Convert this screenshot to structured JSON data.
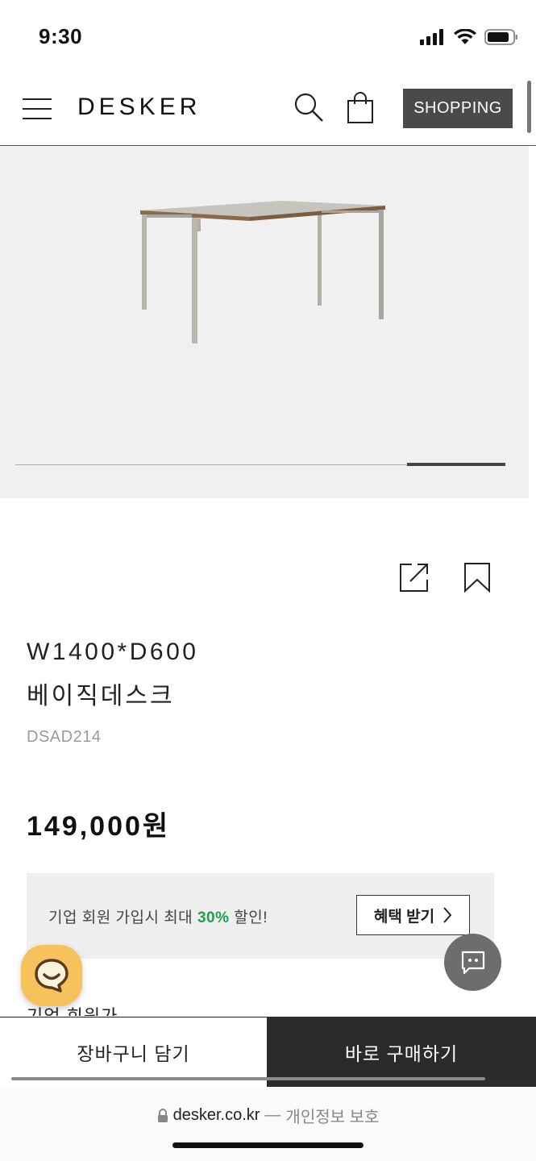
{
  "status_bar": {
    "time": "9:30"
  },
  "header": {
    "brand": "DESKER",
    "shopping_label": "SHOPPING"
  },
  "product": {
    "size": "W1400*D600",
    "name": "베이직데스크",
    "code": "DSAD214",
    "price": "149,000원"
  },
  "benefit": {
    "text_before": "기업 회원 가입시 최대 ",
    "percent": "30%",
    "text_after": " 할인!",
    "button_label": "혜택 받기"
  },
  "corporate_partial_text": "기업 회원가",
  "bottom_bar": {
    "cart_label": "장바구니 담기",
    "buy_label": "바로 구매하기"
  },
  "browser": {
    "domain": "desker.co.kr",
    "separator": "—",
    "privacy": "개인정보 보호"
  },
  "colors": {
    "accent_green": "#1aa34a",
    "chat_yellow": "#f7c15b",
    "dark_button": "#2b2b2b"
  },
  "icons": [
    "signal-icon",
    "wifi-icon",
    "battery-icon",
    "menu-icon",
    "search-icon",
    "bag-icon",
    "share-icon",
    "bookmark-icon",
    "chevron-right-icon",
    "chat-smile-icon",
    "chat-bubble-icon",
    "lock-icon"
  ]
}
